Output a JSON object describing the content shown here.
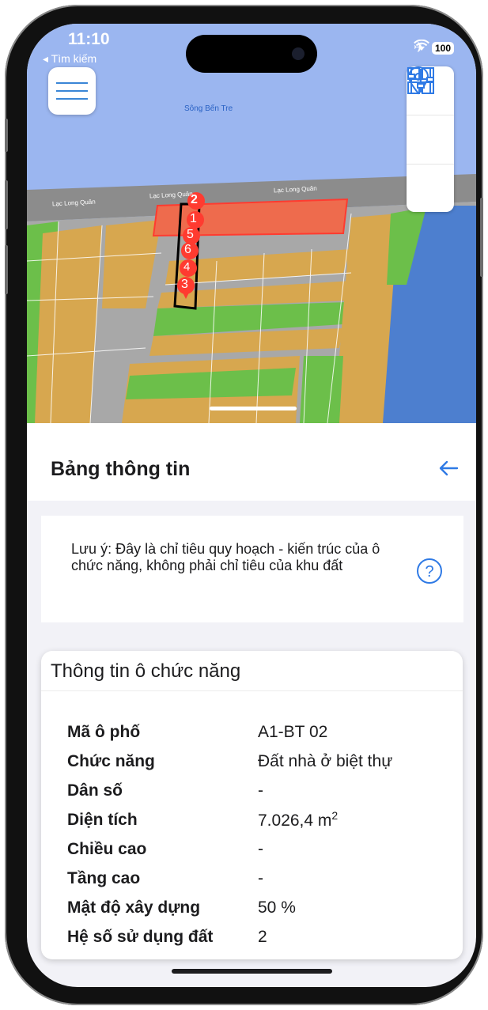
{
  "status_bar": {
    "time": "11:10",
    "back_app": "◂ Tìm kiếm",
    "battery": "100"
  },
  "map": {
    "river_label": "Sông Bến Tre",
    "road_labels": [
      "Lạc Long Quân",
      "Lạc Long Quân",
      "Lạc Long Quân"
    ],
    "markers": [
      "2",
      "1",
      "5",
      "6",
      "4",
      "3"
    ],
    "colors": {
      "water": "#9bb6f0",
      "residential": "#d7a74f",
      "green": "#6cbf4a",
      "road": "#7a7a7a",
      "selected": "#ee6b4d"
    }
  },
  "toolbar": {
    "icons": [
      "menu-icon",
      "layers-grid-icon",
      "location-pin-icon",
      "filter-sliders-icon"
    ]
  },
  "panel": {
    "title": "Bảng thông tin"
  },
  "note": {
    "text": "Lưu ý: Đây là chỉ tiêu quy hoạch - kiến trúc của ô chức năng, không phải chỉ tiêu của khu đất"
  },
  "card": {
    "title": "Thông tin ô chức năng",
    "rows": [
      {
        "label": "Mã ô phố",
        "value": "A1-BT 02"
      },
      {
        "label": "Chức năng",
        "value": "Đất nhà ở biệt thự"
      },
      {
        "label": "Dân số",
        "value": "-"
      },
      {
        "label": "Diện tích",
        "value": "7.026,4  m",
        "sup": "2"
      },
      {
        "label": "Chiều cao",
        "value": "-"
      },
      {
        "label": "Tầng cao",
        "value": "-"
      },
      {
        "label": "Mật độ xây dựng",
        "value": "50 %"
      },
      {
        "label": "Hệ số sử dụng đất",
        "value": "2"
      }
    ]
  },
  "accent_color": "#2f7ae5"
}
